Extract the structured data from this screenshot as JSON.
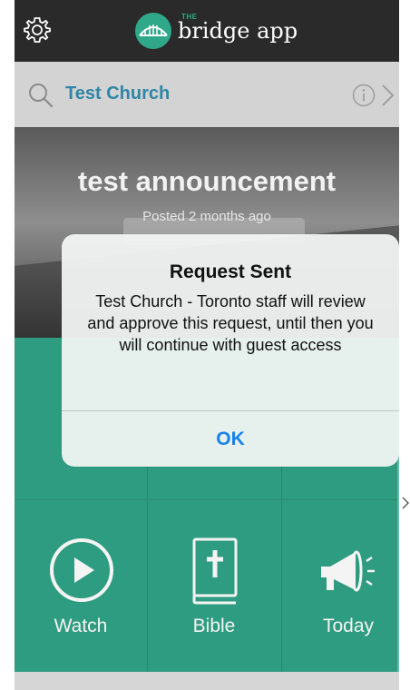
{
  "header": {
    "brand_prefix": "THE",
    "brand_name": "bridge app",
    "icons": {
      "settings": "gear-icon",
      "logo": "bridge-logo-icon"
    }
  },
  "search": {
    "church_name": "Test Church",
    "icons": {
      "search": "search-icon",
      "info": "info-icon",
      "next": "chevron-right-icon"
    },
    "link_color": "#2e86a6"
  },
  "hero": {
    "title": "test announcement",
    "posted": "Posted 2 months ago"
  },
  "tiles": [
    {
      "label": "Watch",
      "icon": "play-circle-icon"
    },
    {
      "label": "Bible",
      "icon": "bible-icon"
    },
    {
      "label": "Today",
      "icon": "megaphone-icon"
    }
  ],
  "alert": {
    "title": "Request Sent",
    "message": "Test Church - Toronto staff will review and approve this request, until then you will continue with guest access",
    "ok_label": "OK"
  },
  "colors": {
    "topbar": "#2a2a2a",
    "accent_green": "#2e9c80",
    "alert_button": "#1a82e6"
  }
}
